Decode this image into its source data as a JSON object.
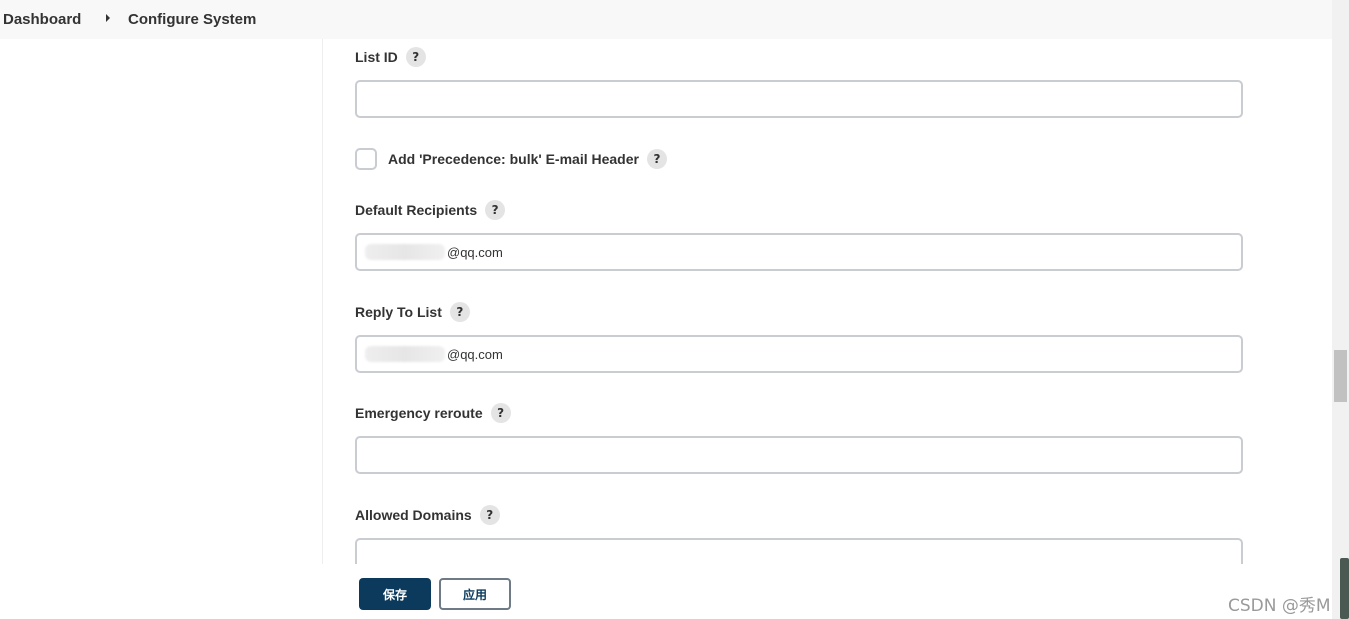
{
  "breadcrumb": {
    "items": [
      "Dashboard",
      "Configure System"
    ]
  },
  "fields": {
    "list_id": {
      "label": "List ID",
      "value": ""
    },
    "precedence_checkbox": {
      "label": "Add 'Precedence: bulk' E-mail Header",
      "checked": false
    },
    "default_recipients": {
      "label": "Default Recipients",
      "value_suffix": "@qq.com"
    },
    "reply_to_list": {
      "label": "Reply To List",
      "value_suffix": "@qq.com"
    },
    "emergency_reroute": {
      "label": "Emergency reroute",
      "value": ""
    },
    "allowed_domains": {
      "label": "Allowed Domains",
      "value": ""
    }
  },
  "help_glyph": "?",
  "buttons": {
    "save": "保存",
    "apply": "应用"
  },
  "watermark": "CSDN @秀M",
  "colors": {
    "primary_button": "#0b3a5c",
    "breadcrumb_bg": "#f8f8f8"
  }
}
